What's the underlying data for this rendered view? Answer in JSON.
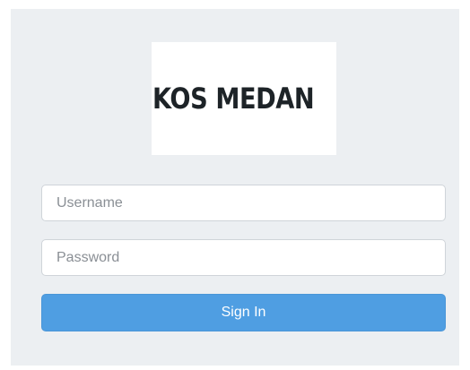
{
  "brand": {
    "logo_text": "KOS MEDAN",
    "logo_icon": "house-logo-icon"
  },
  "login": {
    "username_placeholder": "Username",
    "username_value": "",
    "password_placeholder": "Password",
    "password_value": "",
    "signin_label": "Sign In"
  },
  "colors": {
    "panel_background": "#eceff2",
    "button_primary": "#4f9ee2",
    "logo_roof": "#f07a3b",
    "logo_body": "#f3c63a",
    "logo_fence": "#8bc53f"
  }
}
